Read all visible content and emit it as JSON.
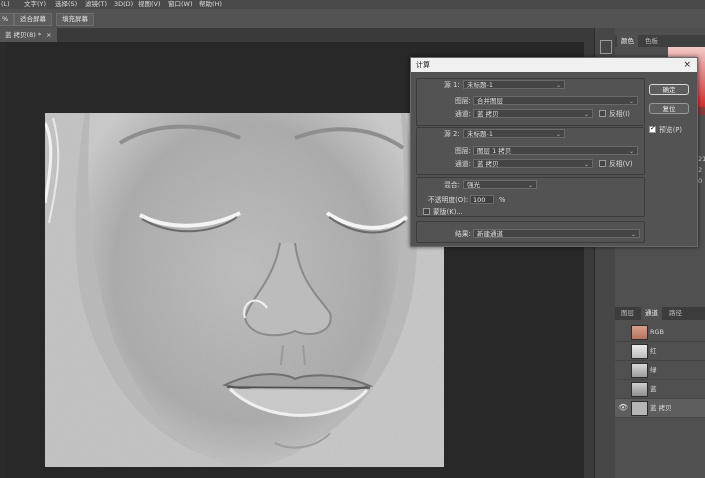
{
  "menubar": {
    "items": [
      "(L)",
      "文字(Y)",
      "选择(S)",
      "滤镜(T)",
      "3D(D)",
      "视图(V)",
      "窗口(W)",
      "帮助(H)"
    ]
  },
  "optionsbar": {
    "buttons": [
      "%",
      "适合屏幕",
      "填充屏幕"
    ]
  },
  "document": {
    "tab_label": "蓝 拷贝(8) *",
    "tab_close": "×"
  },
  "right_panel": {
    "top_tabs": [
      "颜色",
      "色板"
    ],
    "channel_tabs": [
      "图层",
      "通道",
      "路径"
    ],
    "channels": [
      {
        "name": "RGB",
        "visible": false
      },
      {
        "name": "红",
        "visible": false
      },
      {
        "name": "绿",
        "visible": false
      },
      {
        "name": "蓝",
        "visible": false
      },
      {
        "name": "蓝 拷贝",
        "visible": true,
        "selected": true
      }
    ],
    "side_numbers": [
      "21",
      "2",
      "0"
    ],
    "eye_glyph": "👁"
  },
  "dialog": {
    "title": "计算",
    "close": "×",
    "source1": {
      "label": "源 1:",
      "value": "未标题-1",
      "layer_label": "图层:",
      "layer_value": "合并图层",
      "channel_label": "通道:",
      "channel_value": "蓝 拷贝",
      "invert_label": "反相(I)",
      "invert_checked": false
    },
    "source2": {
      "label": "源 2:",
      "value": "未标题-1",
      "layer_label": "图层:",
      "layer_value": "图层 1 拷贝",
      "channel_label": "通道:",
      "channel_value": "蓝 拷贝",
      "invert_label": "反相(V)",
      "invert_checked": false
    },
    "blending": {
      "label": "混合:",
      "value": "强光",
      "opacity_label": "不透明度(O):",
      "opacity_value": "100",
      "opacity_unit": "%",
      "mask_label": "蒙版(K)...",
      "mask_checked": false
    },
    "result": {
      "label": "结果:",
      "value": "新建通道"
    },
    "buttons": {
      "ok": "确定",
      "reset": "复位",
      "preview": "预览(P)",
      "preview_checked": true
    },
    "caret": "⌄"
  }
}
